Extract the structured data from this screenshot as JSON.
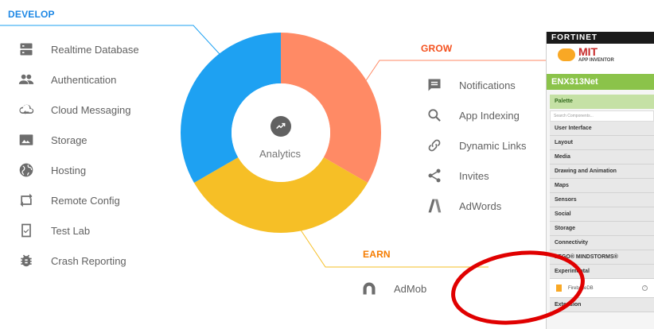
{
  "develop": {
    "title": "DEVELOP",
    "items": [
      {
        "label": "Realtime Database",
        "icon": "database-icon"
      },
      {
        "label": "Authentication",
        "icon": "people-icon"
      },
      {
        "label": "Cloud Messaging",
        "icon": "cloud-sync-icon"
      },
      {
        "label": "Storage",
        "icon": "image-folder-icon"
      },
      {
        "label": "Hosting",
        "icon": "globe-icon"
      },
      {
        "label": "Remote Config",
        "icon": "remote-config-icon"
      },
      {
        "label": "Test Lab",
        "icon": "device-check-icon"
      },
      {
        "label": "Crash Reporting",
        "icon": "bug-icon"
      }
    ]
  },
  "grow": {
    "title": "GROW",
    "items": [
      {
        "label": "Notifications",
        "icon": "message-icon"
      },
      {
        "label": "App Indexing",
        "icon": "search-icon"
      },
      {
        "label": "Dynamic Links",
        "icon": "link-icon"
      },
      {
        "label": "Invites",
        "icon": "share-icon"
      },
      {
        "label": "AdWords",
        "icon": "adwords-icon"
      }
    ]
  },
  "earn": {
    "title": "EARN",
    "items": [
      {
        "label": "AdMob",
        "icon": "admob-icon"
      }
    ]
  },
  "center": {
    "label": "Analytics",
    "icon": "trending-up-icon"
  },
  "colors": {
    "develop": "#1ea1f2",
    "grow": "#ff8a65",
    "earn": "#f6bf26",
    "annotation": "#e00000"
  },
  "panel": {
    "brand": "FORTINET",
    "logo_text": "MIT",
    "logo_sub": "APP INVENTOR",
    "project": "ENX313Net",
    "palette": "Palette",
    "search_placeholder": "Search Components...",
    "categories": [
      "User Interface",
      "Layout",
      "Media",
      "Drawing and Animation",
      "Maps",
      "Sensors",
      "Social",
      "Storage",
      "Connectivity",
      "LEGO® MINDSTORMS®",
      "Experimental"
    ],
    "selected_component": "FirebaseDB",
    "last_category": "Extension"
  }
}
